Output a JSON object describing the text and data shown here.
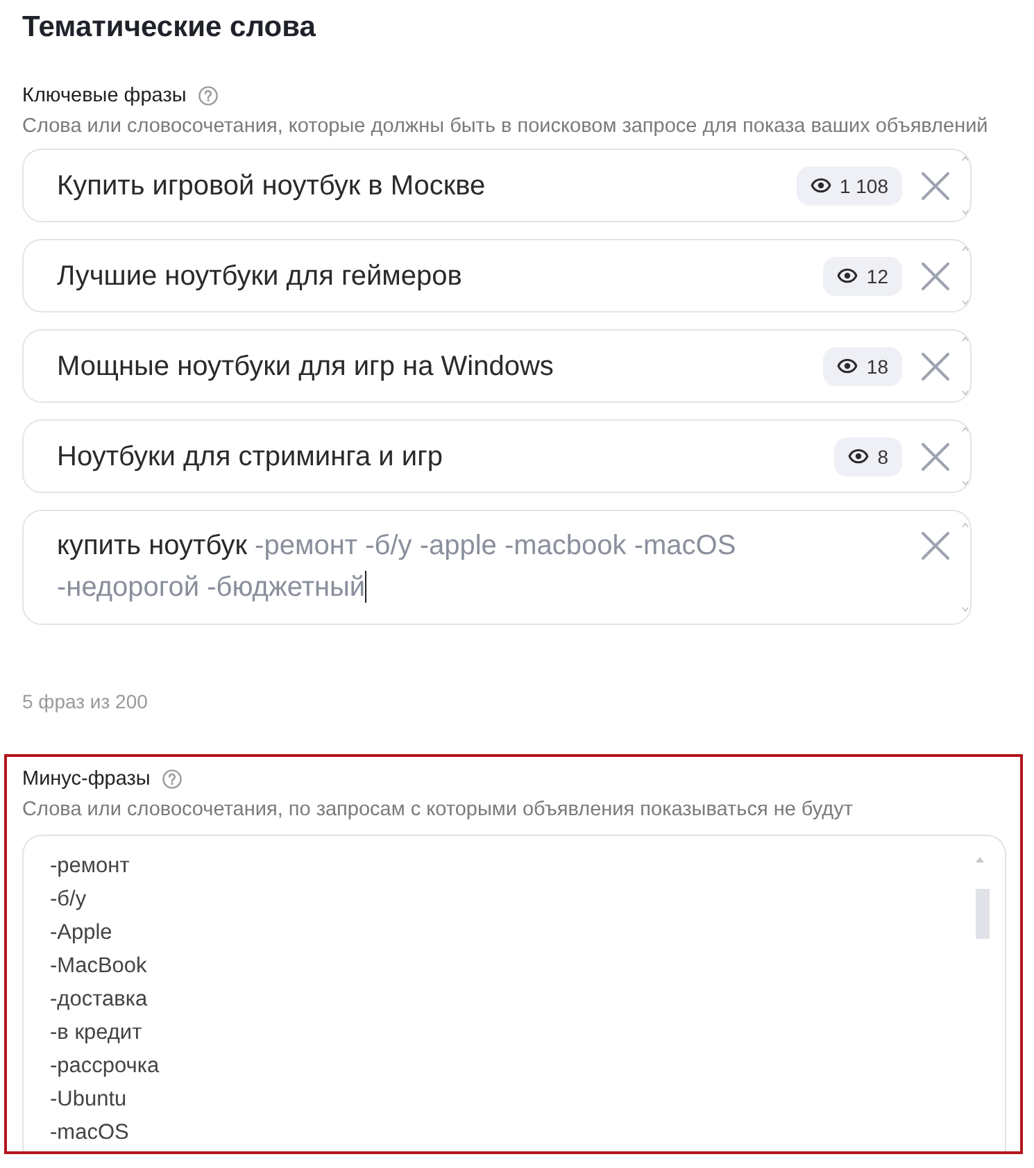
{
  "section": {
    "title": "Тематические слова"
  },
  "keywords": {
    "label": "Ключевые фразы",
    "hint": "Слова или словосочетания, которые должны быть в поисковом запросе для показа ваших объявлений",
    "phrases": [
      {
        "kind": "saved",
        "text": "Купить игровой ноутбук в Москве",
        "impressions": "1 108"
      },
      {
        "kind": "saved",
        "text": "Лучшие ноутбуки для геймеров",
        "impressions": "12"
      },
      {
        "kind": "saved",
        "text": "Мощные ноутбуки для игр на Windows",
        "impressions": "18"
      },
      {
        "kind": "saved",
        "text": "Ноутбуки для стриминга и игр",
        "impressions": "8"
      },
      {
        "kind": "editing",
        "text": "купить ноутбук",
        "minus_words": "-ремонт -б/у -apple -macbook -macOS -недорогой -бюджетный",
        "focused": true
      }
    ],
    "counter": "5 фраз из 200"
  },
  "minus_phrases": {
    "label": "Минус-фразы",
    "hint": "Слова или словосочетания, по запросам с которыми объявления показываться не будут",
    "highlighted": true,
    "lines": [
      "-ремонт",
      "-б/у",
      "-Apple",
      "-MacBook",
      "-доставка",
      "-в кредит",
      "-рассрочка",
      "-Ubuntu",
      "-macOS"
    ]
  }
}
